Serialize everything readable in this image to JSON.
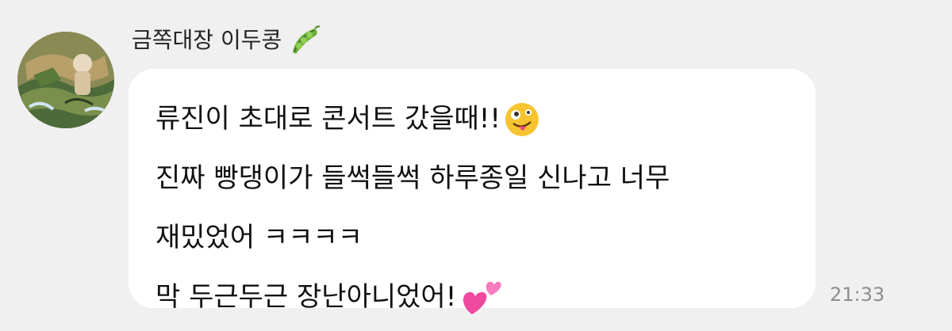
{
  "sender": {
    "name": "금쪽대장 이두콩",
    "name_icon": "pea-pod-icon",
    "avatar_icon": "avatar-image"
  },
  "message": {
    "lines": [
      "류진이 초대로 콘서트 갔을때!!",
      "진짜 빵댕이가 들썩들썩 하루종일 신나고 너무",
      "재밌었어 ㅋㅋㅋㅋ",
      "막 두근두근 장난아니었어!"
    ],
    "line1_emoji": "zany-face-icon",
    "line4_emoji": "two-hearts-icon",
    "timestamp": "21:33"
  },
  "colors": {
    "background": "#f0f0f0",
    "bubble": "#ffffff",
    "timestamp": "#8e8e8e",
    "text": "#111111"
  }
}
